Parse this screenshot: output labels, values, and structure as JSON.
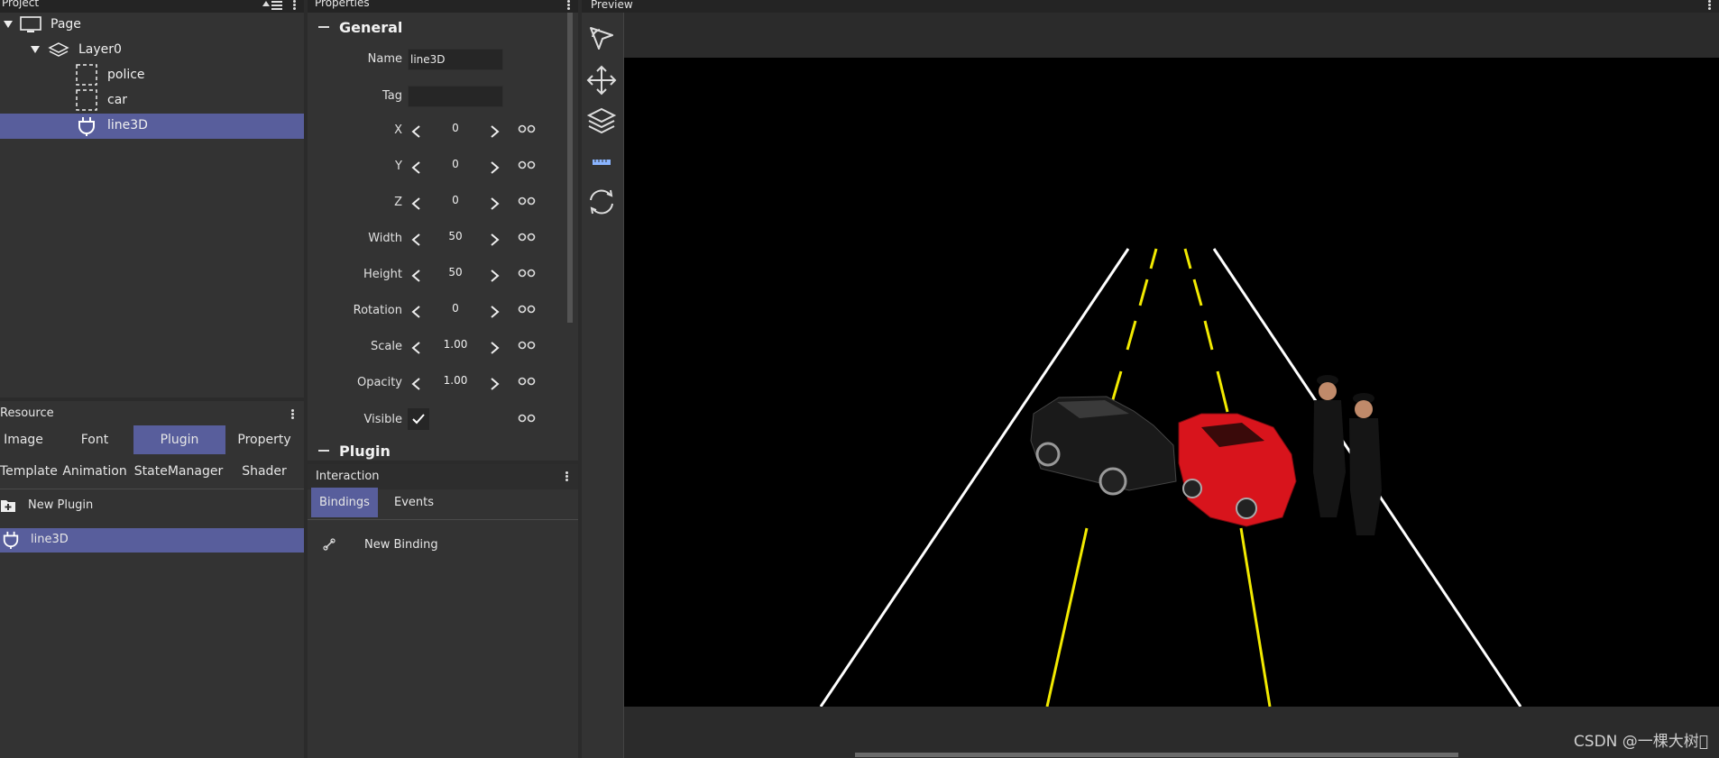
{
  "project": {
    "title": "Project",
    "items": [
      {
        "label": "Page"
      },
      {
        "label": "Layer0"
      },
      {
        "label": "police"
      },
      {
        "label": "car"
      },
      {
        "label": "line3D"
      }
    ]
  },
  "resource": {
    "title": "Resource",
    "tabs_row1": [
      "Image",
      "Font",
      "Plugin",
      "Property"
    ],
    "tabs_row2": [
      "Template",
      "Animation",
      "StateManager",
      "Shader"
    ],
    "new_plugin": "New Plugin",
    "plugin_item": "line3D"
  },
  "properties": {
    "title": "Properties",
    "section_general": "General",
    "section_plugin": "Plugin",
    "name_label": "Name",
    "name_value": "line3D",
    "tag_label": "Tag",
    "tag_value": "",
    "rows": [
      {
        "label": "X",
        "value": "0"
      },
      {
        "label": "Y",
        "value": "0"
      },
      {
        "label": "Z",
        "value": "0"
      },
      {
        "label": "Width",
        "value": "50"
      },
      {
        "label": "Height",
        "value": "50"
      },
      {
        "label": "Rotation",
        "value": "0"
      },
      {
        "label": "Scale",
        "value": "1.00"
      },
      {
        "label": "Opacity",
        "value": "1.00"
      }
    ],
    "visible_label": "Visible",
    "visible_checked": true
  },
  "interaction": {
    "title": "Interaction",
    "tabs": [
      "Bindings",
      "Events"
    ],
    "new_binding": "New Binding"
  },
  "preview": {
    "title": "Preview"
  },
  "watermark": "CSDN @一棵大树\u0000",
  "colors": {
    "selection": "#585e9c",
    "panel": "#333333",
    "header": "#242424",
    "road_line_white": "#ffffff",
    "road_line_yellow": "#f2ea00",
    "car_red": "#d8141c"
  }
}
